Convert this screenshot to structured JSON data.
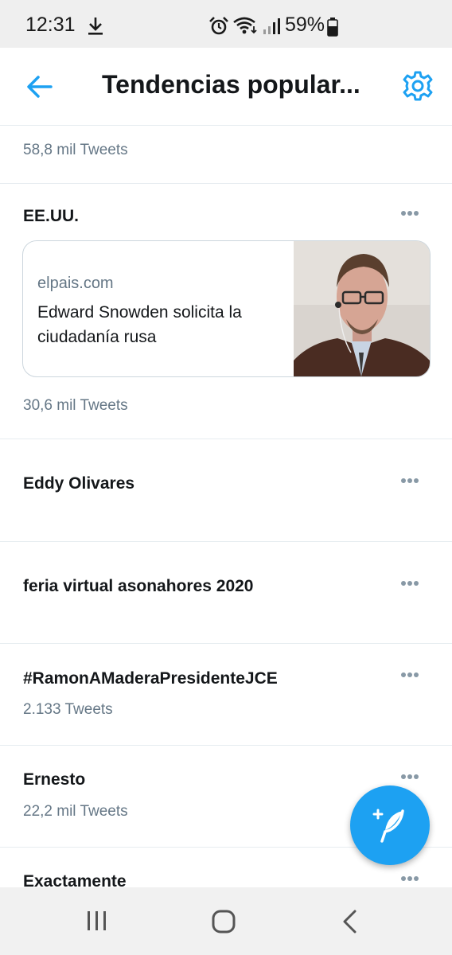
{
  "status_bar": {
    "time": "12:31",
    "battery": "59%",
    "icons": [
      "download-icon",
      "alarm-icon",
      "wifi-icon",
      "signal-icon",
      "battery-icon"
    ]
  },
  "header": {
    "title": "Tendencias popular...",
    "back_icon": "back-arrow-icon",
    "settings_icon": "gear-icon",
    "accent_color": "#1da1f2"
  },
  "trends": [
    {
      "name": "",
      "count": "58,8 mil Tweets"
    },
    {
      "name": "EE.UU.",
      "count": "30,6 mil Tweets",
      "card": {
        "domain": "elpais.com",
        "headline": "Edward Snowden solicita la ciudadanía rusa"
      }
    },
    {
      "name": "Eddy Olivares",
      "count": ""
    },
    {
      "name": "feria virtual asonahores 2020",
      "count": ""
    },
    {
      "name": "#RamonAMaderaPresidenteJCE",
      "count": "2.133 Tweets"
    },
    {
      "name": "Ernesto",
      "count": "22,2 mil Tweets"
    },
    {
      "name": "Exactamente",
      "count": ""
    }
  ],
  "fab": {
    "icon": "compose-tweet-icon",
    "color": "#1da1f2"
  },
  "nav_bar": {
    "icons": [
      "recent-apps-icon",
      "home-icon",
      "back-icon"
    ]
  }
}
